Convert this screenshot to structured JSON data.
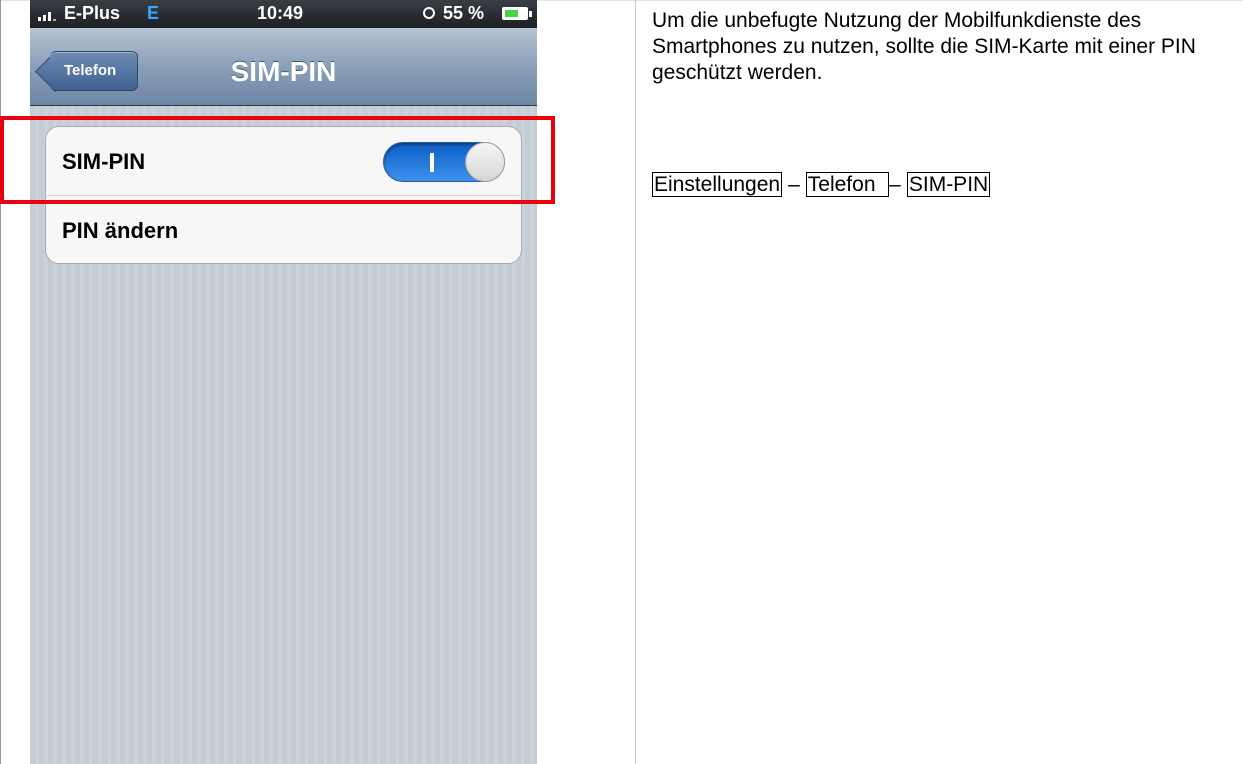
{
  "status_bar": {
    "carrier": "E-Plus",
    "network": "E",
    "time": "10:49",
    "battery": "55 %"
  },
  "nav_bar": {
    "back_label": "Telefon",
    "title": "SIM-PIN"
  },
  "settings": {
    "rows": [
      {
        "label": "SIM-PIN",
        "toggle_on": true,
        "toggle_on_mark": "I"
      },
      {
        "label": "PIN ändern"
      }
    ]
  },
  "document": {
    "description": "Um die unbefugte Nutzung der Mobilfunkdienste des Smartphones zu nutzen, sollte die SIM-Karte mit einer PIN geschützt werden.",
    "path": [
      "Einstellungen",
      "Telefon",
      "SIM-PIN"
    ],
    "separator": "–"
  },
  "colors": {
    "highlight": "#e8000e",
    "toggle_on": "#1f7ae0",
    "network_indicator": "#3ba4ff"
  }
}
